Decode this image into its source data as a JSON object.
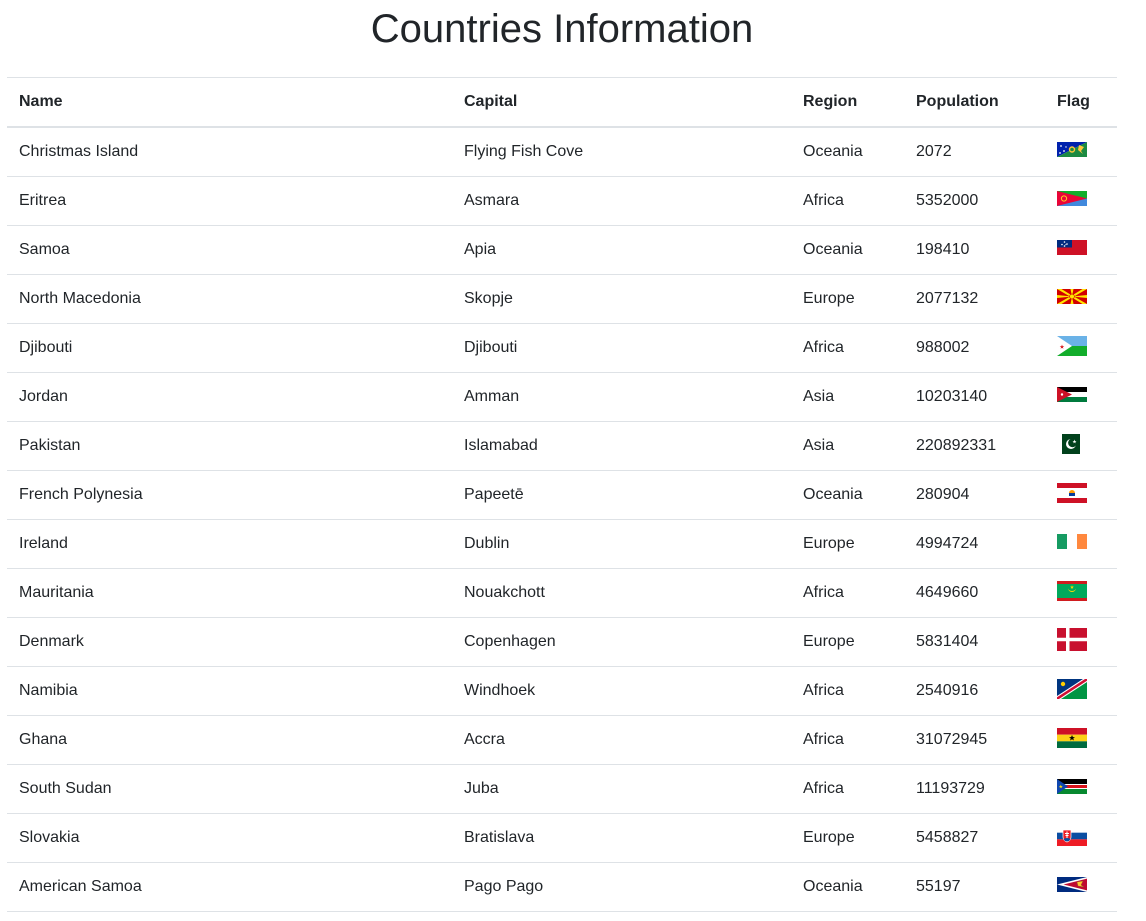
{
  "page": {
    "title": "Countries Information"
  },
  "table": {
    "headers": {
      "name": "Name",
      "capital": "Capital",
      "region": "Region",
      "population": "Population",
      "flag": "Flag"
    },
    "rows": [
      {
        "name": "Christmas Island",
        "capital": "Flying Fish Cove",
        "region": "Oceania",
        "population": "2072",
        "flag": "christmas-island-flag-icon"
      },
      {
        "name": "Eritrea",
        "capital": "Asmara",
        "region": "Africa",
        "population": "5352000",
        "flag": "eritrea-flag-icon"
      },
      {
        "name": "Samoa",
        "capital": "Apia",
        "region": "Oceania",
        "population": "198410",
        "flag": "samoa-flag-icon"
      },
      {
        "name": "North Macedonia",
        "capital": "Skopje",
        "region": "Europe",
        "population": "2077132",
        "flag": "north-macedonia-flag-icon"
      },
      {
        "name": "Djibouti",
        "capital": "Djibouti",
        "region": "Africa",
        "population": "988002",
        "flag": "djibouti-flag-icon"
      },
      {
        "name": "Jordan",
        "capital": "Amman",
        "region": "Asia",
        "population": "10203140",
        "flag": "jordan-flag-icon"
      },
      {
        "name": "Pakistan",
        "capital": "Islamabad",
        "region": "Asia",
        "population": "220892331",
        "flag": "pakistan-flag-icon"
      },
      {
        "name": "French Polynesia",
        "capital": "Papeetē",
        "region": "Oceania",
        "population": "280904",
        "flag": "french-polynesia-flag-icon"
      },
      {
        "name": "Ireland",
        "capital": "Dublin",
        "region": "Europe",
        "population": "4994724",
        "flag": "ireland-flag-icon"
      },
      {
        "name": "Mauritania",
        "capital": "Nouakchott",
        "region": "Africa",
        "population": "4649660",
        "flag": "mauritania-flag-icon"
      },
      {
        "name": "Denmark",
        "capital": "Copenhagen",
        "region": "Europe",
        "population": "5831404",
        "flag": "denmark-flag-icon"
      },
      {
        "name": "Namibia",
        "capital": "Windhoek",
        "region": "Africa",
        "population": "2540916",
        "flag": "namibia-flag-icon"
      },
      {
        "name": "Ghana",
        "capital": "Accra",
        "region": "Africa",
        "population": "31072945",
        "flag": "ghana-flag-icon"
      },
      {
        "name": "South Sudan",
        "capital": "Juba",
        "region": "Africa",
        "population": "11193729",
        "flag": "south-sudan-flag-icon"
      },
      {
        "name": "Slovakia",
        "capital": "Bratislava",
        "region": "Europe",
        "population": "5458827",
        "flag": "slovakia-flag-icon"
      },
      {
        "name": "American Samoa",
        "capital": "Pago Pago",
        "region": "Oceania",
        "population": "55197",
        "flag": "american-samoa-flag-icon"
      }
    ]
  },
  "colors": {
    "text": "#212529",
    "border": "#dee2e6",
    "background": "#ffffff"
  }
}
